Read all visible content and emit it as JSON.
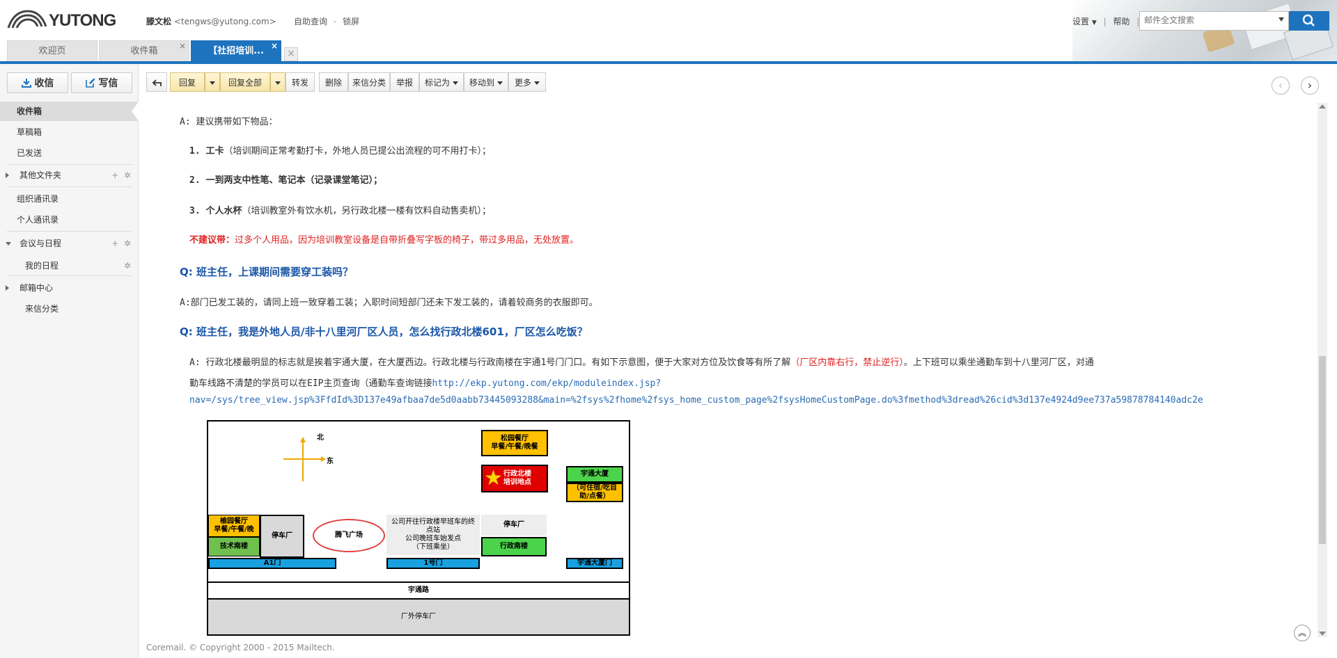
{
  "header": {
    "logo_text": "YUTONG",
    "user_name": "滕文松",
    "user_email": "<tengws@yutong.com>",
    "self_service": "自助查询",
    "lock_screen": "锁屏",
    "settings": "设置",
    "help": "帮助",
    "search_placeholder": "邮件全文搜索"
  },
  "tabs": [
    {
      "label": "欢迎页"
    },
    {
      "label": "收件箱"
    },
    {
      "label": "【社招培训..."
    }
  ],
  "sidebar": {
    "receive_label": "收信",
    "write_label": "写信",
    "items": [
      {
        "label": "收件箱"
      },
      {
        "label": "草稿箱"
      },
      {
        "label": "已发送"
      },
      {
        "label": "其他文件夹"
      },
      {
        "label": "组织通讯录"
      },
      {
        "label": "个人通讯录"
      },
      {
        "label": "会议与日程"
      },
      {
        "label": "我的日程"
      },
      {
        "label": "邮箱中心"
      },
      {
        "label": "来信分类"
      }
    ]
  },
  "toolbar": {
    "reply": "回复",
    "reply_all": "回复全部",
    "forward": "转发",
    "delete": "删除",
    "sender_class": "来信分类",
    "report": "举报",
    "mark_as": "标记为",
    "move_to": "移动到",
    "more": "更多"
  },
  "mail": {
    "a_intro": "A: 建议携带如下物品：",
    "item1_bold": "1. 工卡",
    "item1_note": "（培训期间正常考勤打卡，外地人员已提公出流程的可不用打卡）；",
    "item2": "2. 一到两支中性笔、笔记本（记录课堂笔记）；",
    "item3_bold": "3. 个人水杯",
    "item3_note": "（培训教室外有饮水机，另行政北楼一楼有饮料自动售卖机）；",
    "not_recommended_label": "不建议带：",
    "not_recommended_text": "过多个人用品，因为培训教室设备是自带折叠写字板的椅子，带过多用品，无处放置。",
    "q2": "Q: 班主任，上课期间需要穿工装吗？",
    "a2": "A:部门已发工装的，请同上班一致穿着工装；入职时间短部门还未下发工装的，请着较商务的衣服即可。",
    "q3": "Q: 班主任，我是外地人员/非十八里河厂区人员，怎么找行政北楼601，厂区怎么吃饭？",
    "a3_part1": "A: 行政北楼最明显的标志就是挨着宇通大厦，在大厦西边。行政北楼与行政南楼在宇通1号门门口。有如下示意图，便于大家对方位及饮食等有所了解",
    "a3_red": "（厂区内靠右行，禁止逆行）",
    "a3_part2": "。上下班可以乘坐通勤车到十八里河厂区，对通",
    "a3_line2": "勤车线路不清楚的学员可以在EIP主页查询（通勤车查询链接",
    "link_part1": "http://ekp.yutong.com/ekp/moduleindex.jsp?",
    "link_part2": "nav=/sys/tree_view.jsp%3FfdId%3D137e49afbaa7de5d0aabb73445093288&main=%2fsys%2fhome%2fsys_home_custom_page%2fsysHomeCustomPage.do%3fmethod%3dread%26cid%3d137e4924d9ee737a59878784140adc2e"
  },
  "map": {
    "north": "北",
    "east": "东",
    "songyuan": "松园餐厅\n早餐/午餐/晚餐",
    "admin_north": "行政北楼\n培训地点",
    "yutong_tower": "宇通大厦",
    "tower_note": "（可住宿/吃自\n助/点餐）",
    "yuyuan": "榆园餐厅\n早餐/午餐/晚",
    "parking1": "停车厂",
    "tengfei": "腾飞广场",
    "shuttle": "公司开往行政楼早班车的终\n点站\n公司晚班车始发点\n（下班乘坐）",
    "parking2": "停车厂",
    "tech_south": "技术南楼",
    "admin_south": "行政南楼",
    "gate_a1": "A1门",
    "gate_1": "1号门",
    "gate_tower": "宇通大厦门",
    "road": "宇通路",
    "outside_parking": "厂外停车厂"
  },
  "footer": "Coremail. © Copyright 2000 - 2015 Mailtech."
}
